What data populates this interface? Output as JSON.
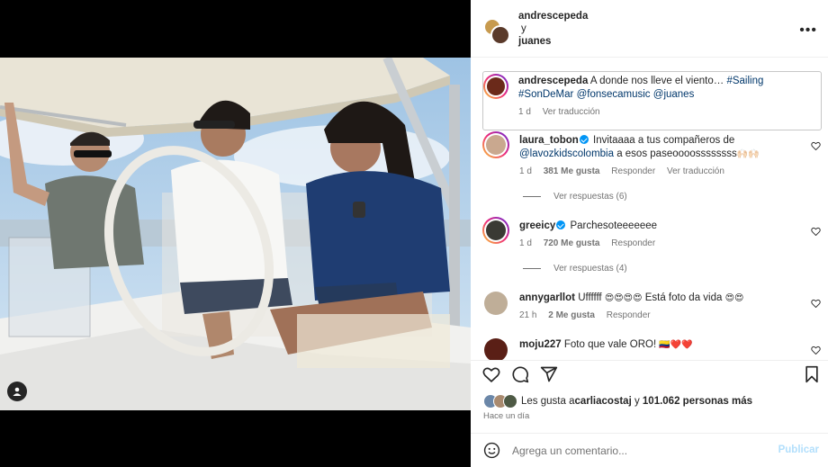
{
  "post": {
    "authors": {
      "first": "andrescepeda",
      "joiner": "y",
      "second": "juanes"
    },
    "more_label": "•••"
  },
  "caption": {
    "username": "andrescepeda",
    "text": "A donde nos lleve el viento… ",
    "hashtag1": "#Sailing",
    "hashtag2": "#SonDeMar",
    "mention1": "@fonsecamusic",
    "mention2": "@juanes",
    "time": "1 d",
    "translate": "Ver traducción"
  },
  "comments": [
    {
      "username": "laura_tobon",
      "text_a": "Invitaaaa a tus compañeros de",
      "mention": "@lavozkidscolombia",
      "text_b": " a esos paseoooossssssss",
      "emoji": "🙌🏻🙌🏻",
      "time": "1 d",
      "likes": "381 Me gusta",
      "reply": "Responder",
      "translate": "Ver traducción",
      "replies": "Ver respuestas (6)"
    },
    {
      "username": "greeicy",
      "text": "Parchesoteeeeeee",
      "time": "1 d",
      "likes": "720 Me gusta",
      "reply": "Responder",
      "replies": "Ver respuestas (4)"
    },
    {
      "username": "annygarllot",
      "text": "Uffffff ",
      "emoji1": "😍😍😍😍",
      "text2": " Está foto da vida ",
      "emoji2": "😍😍",
      "time": "21 h",
      "likes": "2 Me gusta",
      "reply": "Responder"
    },
    {
      "username": "moju227",
      "text": "Foto que vale ORO! ",
      "emoji": "🇨🇴❤️❤️"
    }
  ],
  "likes": {
    "prefix": "Les gusta a ",
    "user": "carliacostaj",
    "joiner": " y ",
    "count": "101.062 personas más"
  },
  "posted_ago": "Hace un día",
  "comment_box": {
    "placeholder": "Agrega un comentario...",
    "publish": "Publicar"
  },
  "icons": [
    "heart-icon",
    "comment-icon",
    "share-icon",
    "bookmark-icon",
    "emoji-icon",
    "more-icon",
    "user-tag-icon"
  ],
  "colors": {
    "link": "#00376b",
    "verified": "#0095f6",
    "publish_disabled": "#b2dffc",
    "meta": "#737373"
  }
}
